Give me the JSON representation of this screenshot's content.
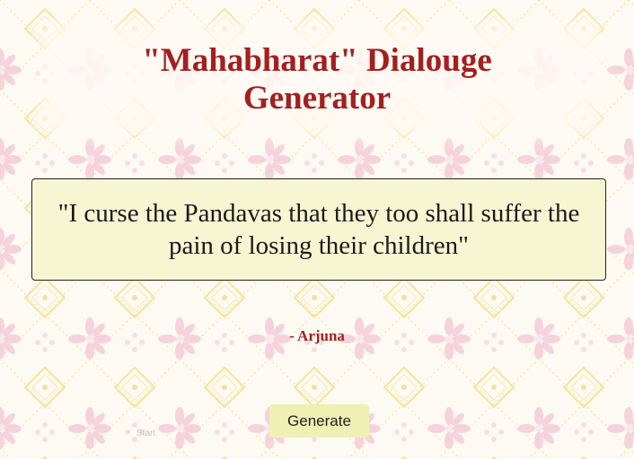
{
  "header": {
    "title_line1": "\"Mahabharat\" Dialouge",
    "title_line2": "Generator"
  },
  "quote": {
    "text": "\"I curse the Pandavas that they too shall suffer the pain of losing their children\"",
    "author": "- Arjuna"
  },
  "controls": {
    "generate_label": "Generate",
    "start_label": "Start"
  },
  "colors": {
    "accent": "#a32020",
    "quote_background": "#f7f6d2",
    "button_background": "#eff0b3",
    "pattern_pink": "#f6d3dc",
    "pattern_yellow": "#f5e39a"
  }
}
